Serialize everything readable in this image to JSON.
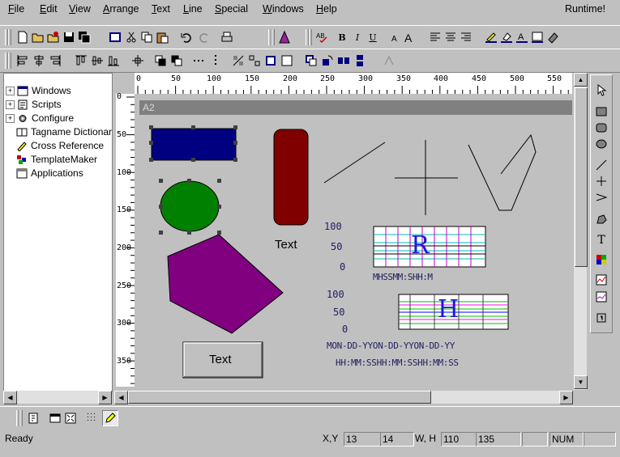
{
  "menu": {
    "items": [
      {
        "label": "File"
      },
      {
        "label": "Edit"
      },
      {
        "label": "View"
      },
      {
        "label": "Arrange"
      },
      {
        "label": "Text"
      },
      {
        "label": "Line"
      },
      {
        "label": "Special"
      },
      {
        "label": "Windows"
      },
      {
        "label": "Help"
      }
    ],
    "mode_label": "Runtime!"
  },
  "tree": {
    "items": [
      {
        "label": "Windows",
        "icon": "window-icon"
      },
      {
        "label": "Scripts",
        "icon": "script-icon"
      },
      {
        "label": "Configure",
        "icon": "configure-icon"
      },
      {
        "label": "Tagname Dictionary",
        "icon": "dictionary-icon"
      },
      {
        "label": "Cross Reference",
        "icon": "cross-reference-icon"
      },
      {
        "label": "TemplateMaker",
        "icon": "template-icon"
      },
      {
        "label": "Applications",
        "icon": "applications-icon"
      }
    ]
  },
  "ruler": {
    "top_labels": [
      "0",
      "50",
      "100",
      "150",
      "200",
      "250",
      "300",
      "350",
      "400",
      "450",
      "500",
      "550"
    ],
    "left_labels": [
      "0",
      "50",
      "100",
      "150",
      "200",
      "250",
      "300",
      "350"
    ]
  },
  "window": {
    "title": "A2"
  },
  "canvas": {
    "text_label": "Text",
    "button_label": "Text",
    "trend1": {
      "scale": [
        "100",
        "50",
        "0"
      ],
      "cursor_letter": "R",
      "time_label": "MHSSMM:SHH:M"
    },
    "trend2": {
      "scale": [
        "100",
        "50",
        "0"
      ],
      "cursor_letter": "H",
      "date_label": "MON-DD-YYON-DD-YYON-DD-YY",
      "time_label": "HH:MM:SSHH:MM:SSHH:MM:SS"
    }
  },
  "status": {
    "text": "Ready",
    "xy_label": "X,Y",
    "x": "13",
    "y": "14",
    "wh_label": "W, H",
    "w": "110",
    "h": "135",
    "num": "NUM"
  },
  "colors": {
    "rect_fill": "#000080",
    "rounded_rect_fill": "#800000",
    "ellipse_fill": "#008000",
    "polygon_fill": "#800080",
    "title_bar": "#808080",
    "cursor_letter": "#1a1adb"
  }
}
